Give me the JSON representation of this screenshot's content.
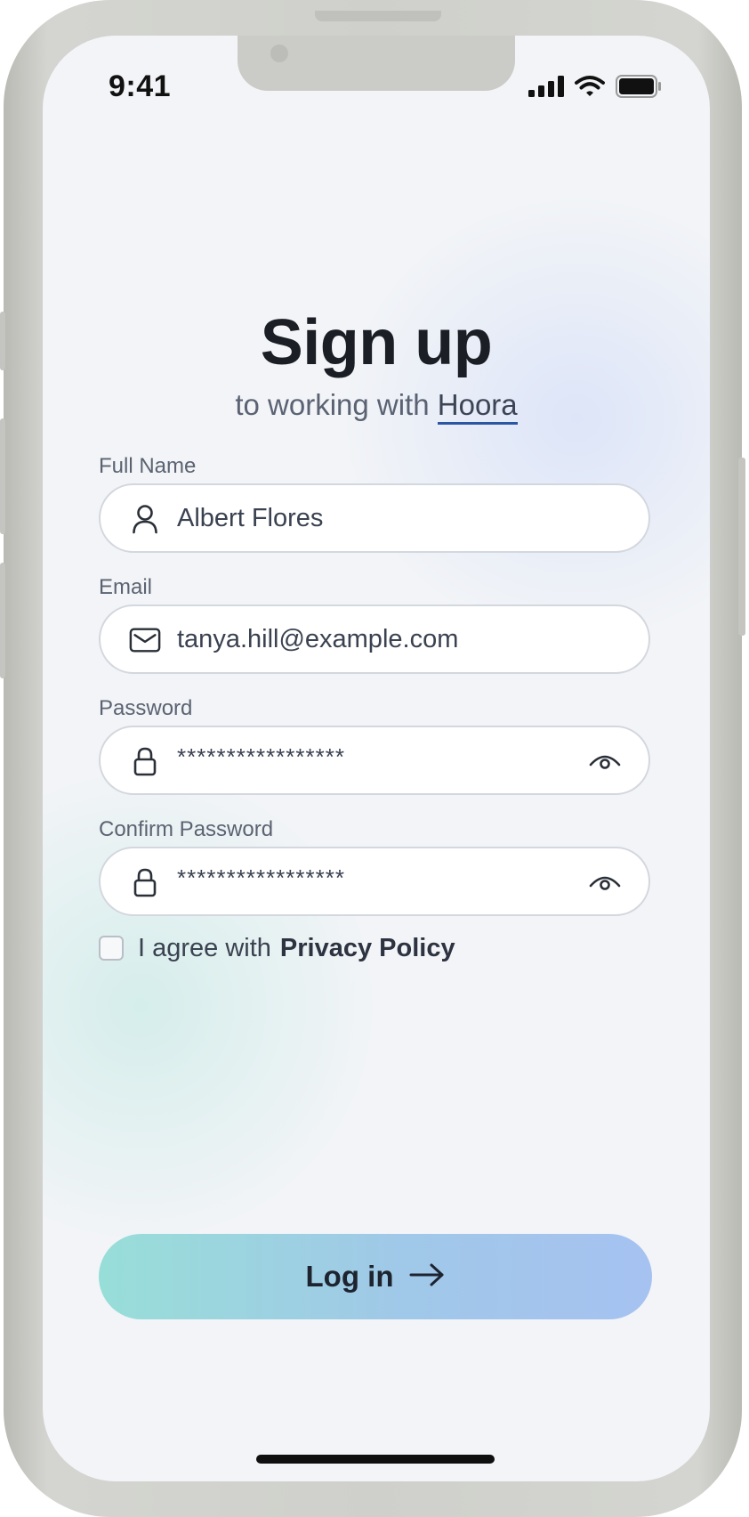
{
  "status_bar": {
    "time": "9:41",
    "icons": [
      "cellular-signal-icon",
      "wifi-icon",
      "battery-icon"
    ]
  },
  "header": {
    "title": "Sign up",
    "subtitle_prefix": "to working with",
    "brand": "Hoora"
  },
  "form": {
    "full_name": {
      "label": "Full Name",
      "value": "Albert Flores",
      "icon": "user-icon"
    },
    "email": {
      "label": "Email",
      "value": "tanya.hill@example.com",
      "icon": "mail-icon"
    },
    "password": {
      "label": "Password",
      "value": "*****************",
      "icon": "lock-icon",
      "toggle_icon": "eye-icon"
    },
    "confirm_password": {
      "label": "Confirm Password",
      "value": "*****************",
      "icon": "lock-icon",
      "toggle_icon": "eye-icon"
    },
    "agree": {
      "text": "I agree with",
      "link": "Privacy Policy",
      "checked": false
    }
  },
  "actions": {
    "login_label": "Log in",
    "login_icon": "arrow-right-icon"
  },
  "colors": {
    "button_gradient_start": "#98ded8",
    "button_gradient_end": "#a6c2f1",
    "brand_underline": "#2b56a4",
    "title": "#1b1e25"
  }
}
